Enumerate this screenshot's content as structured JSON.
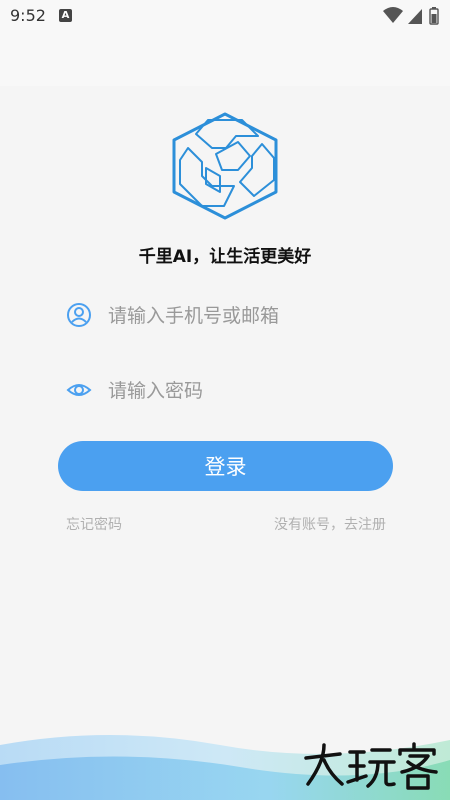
{
  "status": {
    "time": "9:52",
    "badge": "A"
  },
  "brand": {
    "tagline": "千里AI，让生活更美好",
    "accent": "#4ba0f0",
    "logo_color": "#2c8fd9"
  },
  "login": {
    "phone_placeholder": "请输入手机号或邮箱",
    "phone_value": "",
    "password_placeholder": "请输入密码",
    "password_value": "",
    "submit_label": "登录",
    "forgot_label": "忘记密码",
    "register_label": "没有账号，去注册"
  },
  "icons": {
    "phone_field": "user-circle-icon",
    "password_field": "eye-icon"
  },
  "watermark": {
    "text": "大玩客"
  }
}
